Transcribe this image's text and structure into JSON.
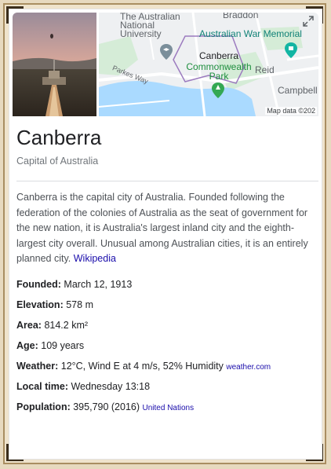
{
  "map": {
    "labels": {
      "anu": "The Australian\nNational\nUniversity",
      "braddon": "Braddon",
      "awm": "Australian War Memorial",
      "canberra": "Canberra",
      "commonwealth_park": "Commonwealth\nPark",
      "reid": "Reid",
      "parkes_way": "Parkes Way",
      "campbell": "Campbell"
    },
    "attribution": "Map data ©202"
  },
  "entity": {
    "title": "Canberra",
    "subtitle": "Capital of Australia"
  },
  "description": {
    "text": "Canberra is the capital city of Australia. Founded following the federation of the colonies of Australia as the seat of government for the new nation, it is Australia's largest inland city and the eighth-largest city overall. Unusual among Australian cities, it is an entirely planned city.",
    "source": "Wikipedia"
  },
  "facts": [
    {
      "label": "Founded:",
      "value": "March 12, 1913",
      "source": ""
    },
    {
      "label": "Elevation:",
      "value": "578 m",
      "source": ""
    },
    {
      "label": "Area:",
      "value": "814.2 km²",
      "source": ""
    },
    {
      "label": "Age:",
      "value": "109 years",
      "source": ""
    },
    {
      "label": "Weather:",
      "value": "12°C, Wind E at 4 m/s, 52% Humidity",
      "source": "weather.com"
    },
    {
      "label": "Local time:",
      "value": "Wednesday 13:18",
      "source": ""
    },
    {
      "label": "Population:",
      "value": "395,790 (2016)",
      "source": "United Nations"
    }
  ],
  "colors": {
    "link": "#1a0dab",
    "frame": "#a98e61",
    "park_green": "#1e8e3e",
    "water": "#aadaff"
  },
  "icons": [
    "expand-icon",
    "university-pin-icon",
    "memorial-pin-icon",
    "park-pin-icon"
  ]
}
